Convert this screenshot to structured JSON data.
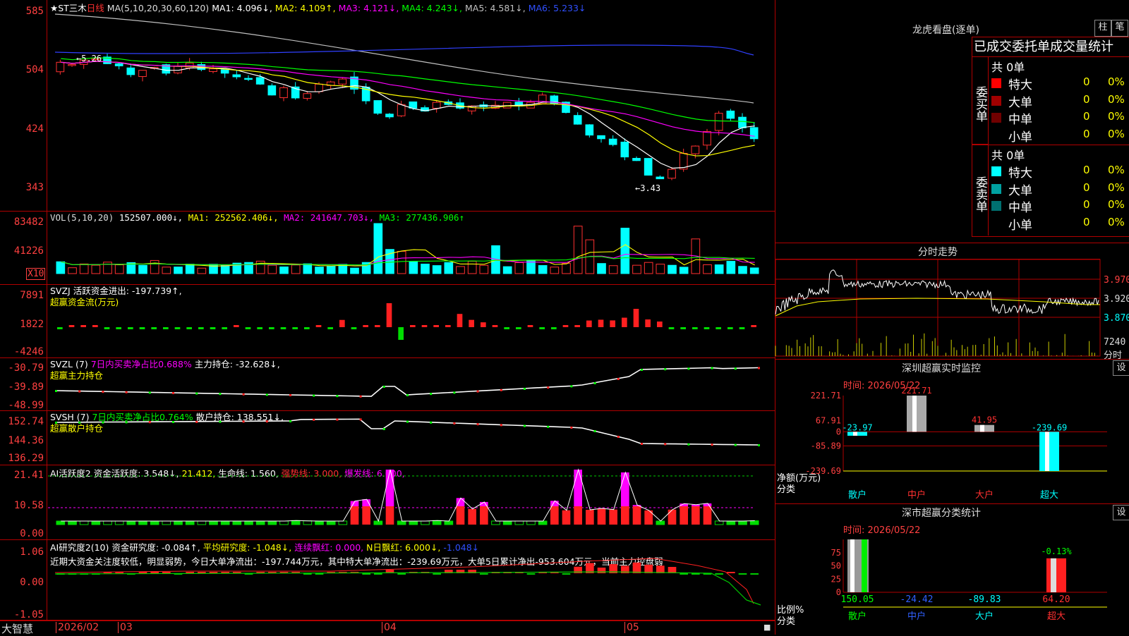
{
  "kline": {
    "title_star": "★",
    "title": "ST三木",
    "period": "日线",
    "ma_label": "MA(5,10,20,30,60,120)",
    "ma1": "MA1: 4.096↓,",
    "ma2": "MA2: 4.109↑,",
    "ma3": "MA3: 4.121↓,",
    "ma4": "MA4: 4.243↓,",
    "ma5": "MA5: 4.581↓,",
    "ma6": "MA6: 5.233↓",
    "y_ticks": [
      "585",
      "504",
      "424",
      "343"
    ],
    "y_values": [
      5.85,
      5.04,
      4.24,
      3.43
    ],
    "annot_high": "←5.26",
    "annot_low": "←3.43",
    "colors": {
      "up": "#ff3030",
      "down": "#00ffff",
      "ma1": "#ffffff",
      "ma2": "#ffff00",
      "ma3": "#ff00ff",
      "ma4": "#00ff00",
      "ma5": "#c0c0c0",
      "ma6": "#3040ff"
    }
  },
  "vol": {
    "label": "VOL(5,10,20)",
    "value": "152507.000↓,",
    "ma1": "MA1: 252562.406↓,",
    "ma2": "MA2: 241647.703↓,",
    "ma3": "MA3: 277436.906↑",
    "y_ticks": [
      "83482",
      "41226"
    ],
    "unit": "X10"
  },
  "svzj": {
    "label": "SVZJ  活跃资金进出: -197.739↑,",
    "sub": "超赢资金流(万元)",
    "y_ticks": [
      "7891",
      "1822",
      "-4246"
    ]
  },
  "svzl": {
    "label": "SVZL (7)",
    "ratio": "7日内买卖净占比0.688%",
    "main": "主力持仓: -32.628↓,",
    "sub": "超赢主力持仓",
    "y_ticks": [
      "-30.79",
      "-39.89",
      "-48.99"
    ]
  },
  "svsh": {
    "label": "SVSH (7)",
    "ratio": "7日内买卖净占比0.764%",
    "main": "散户持仓: 138.551↓,",
    "sub": "超赢散户持仓",
    "y_ticks": [
      "152.74",
      "144.36",
      "136.29"
    ]
  },
  "ai_active": {
    "label": "AI活跃度2",
    "a": "资金活跃度: 3.548↓,",
    "b": "21.412,",
    "c": "生命线: 1.560,",
    "d": "强势线: 3.000,",
    "e": "爆发线: 6.000,",
    "y_ticks": [
      "21.41",
      "10.58",
      "0.00"
    ]
  },
  "ai_research": {
    "label": "AI研究度2(10)",
    "a": "资金研究度: -0.084↑,",
    "b": "平均研究度: -1.048↓,",
    "c": "连续飘红: 0.000,",
    "d": "N日飘红: 6.000↓,",
    "e": "-1.048↓",
    "comment": "近期大资金关注度较低，明显弱势，今日大单净流出：-197.744万元，其中特大单净流出：-239.69万元，大单5日累计净出-953.604万元，当前主力控盘弱",
    "y_ticks": [
      "1.06",
      "0.00",
      "-1.05"
    ]
  },
  "footer": {
    "brand": "大智慧",
    "dates": [
      "2026/02",
      "03",
      "04",
      "05"
    ]
  },
  "dragon": {
    "title": "龙虎看盘(逐单)",
    "btn1": "柱",
    "btn2": "笔",
    "header": "已成交委托单成交量统计",
    "buy_label": "委买单",
    "sell_label": "委卖单",
    "buy_total": "共 0单",
    "sell_total": "共 0单",
    "rows_buy": [
      {
        "name": "特大",
        "count": "0",
        "pct": "0%",
        "color": "#ff0000"
      },
      {
        "name": "大单",
        "count": "0",
        "pct": "0%",
        "color": "#a00000"
      },
      {
        "name": "中单",
        "count": "0",
        "pct": "0%",
        "color": "#700000"
      },
      {
        "name": "小单",
        "count": "0",
        "pct": "0%",
        "color": "#000000"
      }
    ],
    "rows_sell": [
      {
        "name": "特大",
        "count": "0",
        "pct": "0%",
        "color": "#00ffff"
      },
      {
        "name": "大单",
        "count": "0",
        "pct": "0%",
        "color": "#00a0a0"
      },
      {
        "name": "中单",
        "count": "0",
        "pct": "0%",
        "color": "#007070"
      },
      {
        "name": "小单",
        "count": "0",
        "pct": "0%",
        "color": "#000000"
      }
    ]
  },
  "intraday": {
    "title": "分时走势",
    "prices": [
      "3.970",
      "3.920",
      "3.870"
    ],
    "vol": "7240",
    "vol_label": "分时"
  },
  "monitor": {
    "title": "深圳超赢实时监控",
    "btn": "设",
    "time": "时间: 2026/05/22",
    "y_ticks": [
      "221.71",
      "67.91",
      "0",
      "-85.89",
      "-239.69"
    ],
    "x_label_top": "净额(万元)",
    "x_label_bottom": "分类",
    "categories": [
      "散户",
      "中户",
      "大户",
      "超大"
    ],
    "values": [
      -23.97,
      221.71,
      41.95,
      -239.69
    ],
    "value_labels": [
      "-23.97",
      "221.71",
      "41.95",
      "-239.69"
    ]
  },
  "classify": {
    "title": "深市超赢分类统计",
    "btn": "设",
    "time": "时间: 2026/05/22",
    "y_ticks": [
      "75",
      "50",
      "25",
      "0"
    ],
    "top_label": "-0.13%",
    "x_label_top": "比例%",
    "x_label_bottom": "分类",
    "categories": [
      "散户",
      "中户",
      "大户",
      "超大"
    ],
    "values": [
      150.05,
      -24.42,
      -89.83,
      64.2
    ],
    "value_labels": [
      "150.05",
      "-24.42",
      "-89.83",
      "64.20"
    ]
  }
}
